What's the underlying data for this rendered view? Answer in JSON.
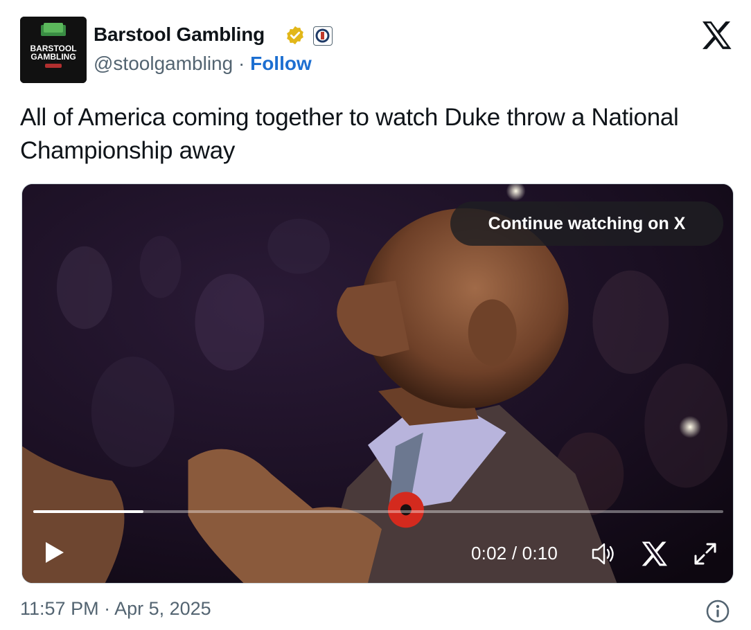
{
  "author": {
    "display_name": "Barstool Gambling",
    "handle": "@stoolgambling",
    "separator": "·",
    "follow_label": "Follow",
    "avatar_line1": "BARSTOOL",
    "avatar_line2": "GAMBLING",
    "verified_badge": "gold-checkmark-icon",
    "affiliate_badge": "barstool-affiliate-icon"
  },
  "tweet": {
    "text": "All of America coming together to watch Duke throw a National Championship away"
  },
  "video": {
    "continue_label": "Continue watching on X",
    "current_time": "0:02",
    "duration": "0:10",
    "time_display": "0:02 / 0:10",
    "progress_fraction": 0.16
  },
  "footer": {
    "timestamp": "11:57 PM · Apr 5, 2025"
  },
  "colors": {
    "follow": "#1d6fd1",
    "verified_gold": "#e2b719",
    "muted_text": "#536471",
    "background": "#ffffff"
  }
}
